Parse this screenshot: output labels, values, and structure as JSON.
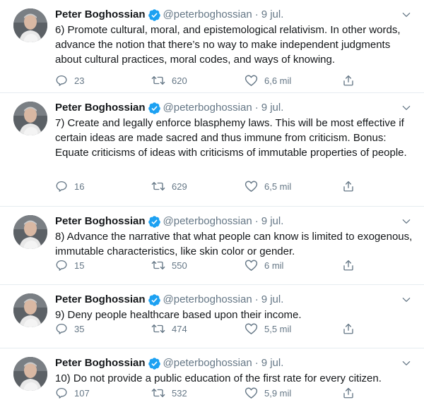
{
  "author": {
    "name": "Peter Boghossian",
    "handle": "@peterboghossian",
    "verified_color": "#1da1f2"
  },
  "tweets": [
    {
      "date": "9 jul.",
      "text": "6) Promote cultural, moral, and epistemological relativism. In other words, advance the notion that there’s no way to make independent judgments about cultural practices, moral codes, and ways of knowing.",
      "replies": "23",
      "retweets": "620",
      "likes": "6,6 mil"
    },
    {
      "date": "9 jul.",
      "text": "7) Create and legally enforce blasphemy laws. This will be most effective if certain ideas are made sacred and thus immune from criticism. Bonus: Equate criticisms of ideas with criticisms of immutable properties of people.",
      "replies": "16",
      "retweets": "629",
      "likes": "6,5 mil"
    },
    {
      "date": "9 jul.",
      "text": "8) Advance the narrative that what people can know is limited to exogenous, immutable characteristics, like skin color or gender.",
      "replies": "15",
      "retweets": "550",
      "likes": "6 mil"
    },
    {
      "date": "9 jul.",
      "text": "9) Deny people healthcare based upon their income.",
      "replies": "35",
      "retweets": "474",
      "likes": "5,5 mil"
    },
    {
      "date": "9 jul.",
      "text": "10) Do not provide a public education of the first rate for every citizen.",
      "replies": "107",
      "retweets": "532",
      "likes": "5,9 mil"
    }
  ],
  "icons": {
    "reply": "reply-icon",
    "retweet": "retweet-icon",
    "like": "heart-icon",
    "share": "share-icon",
    "menu": "chevron-down-icon",
    "verified": "verified-badge-icon"
  }
}
